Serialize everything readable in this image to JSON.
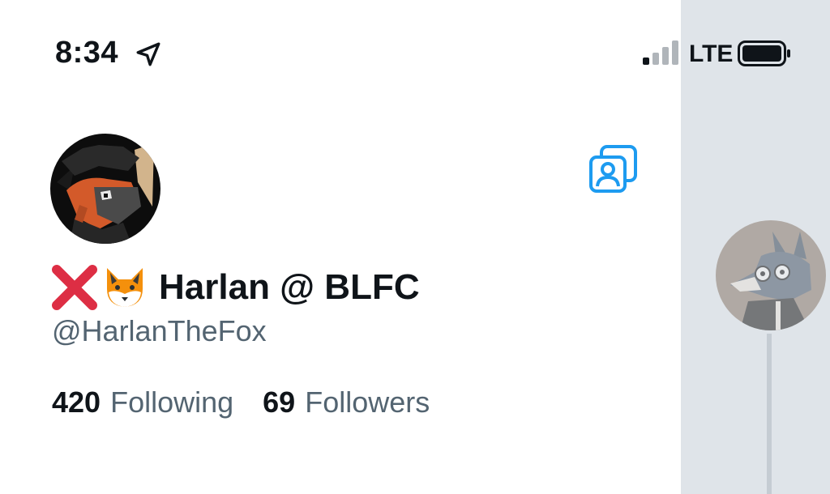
{
  "status_bar": {
    "time": "8:34",
    "carrier": "LTE",
    "location_icon": "location-arrow-icon",
    "signal_icon": "cellular-signal-icon",
    "battery_icon": "battery-icon"
  },
  "profile": {
    "display_name": "Harlan @ BLFC",
    "name_emojis": [
      "cross-mark-icon",
      "fox-face-icon"
    ],
    "handle": "@HarlanTheFox",
    "following_count": "420",
    "following_label": "Following",
    "followers_count": "69",
    "followers_label": "Followers",
    "accounts_icon": "switch-accounts-icon"
  },
  "colors": {
    "text_primary": "#0f1419",
    "text_secondary": "#536471",
    "accent": "#1d9bf0",
    "cross_red": "#dd2e44",
    "overlay": "#dfe4e9"
  }
}
